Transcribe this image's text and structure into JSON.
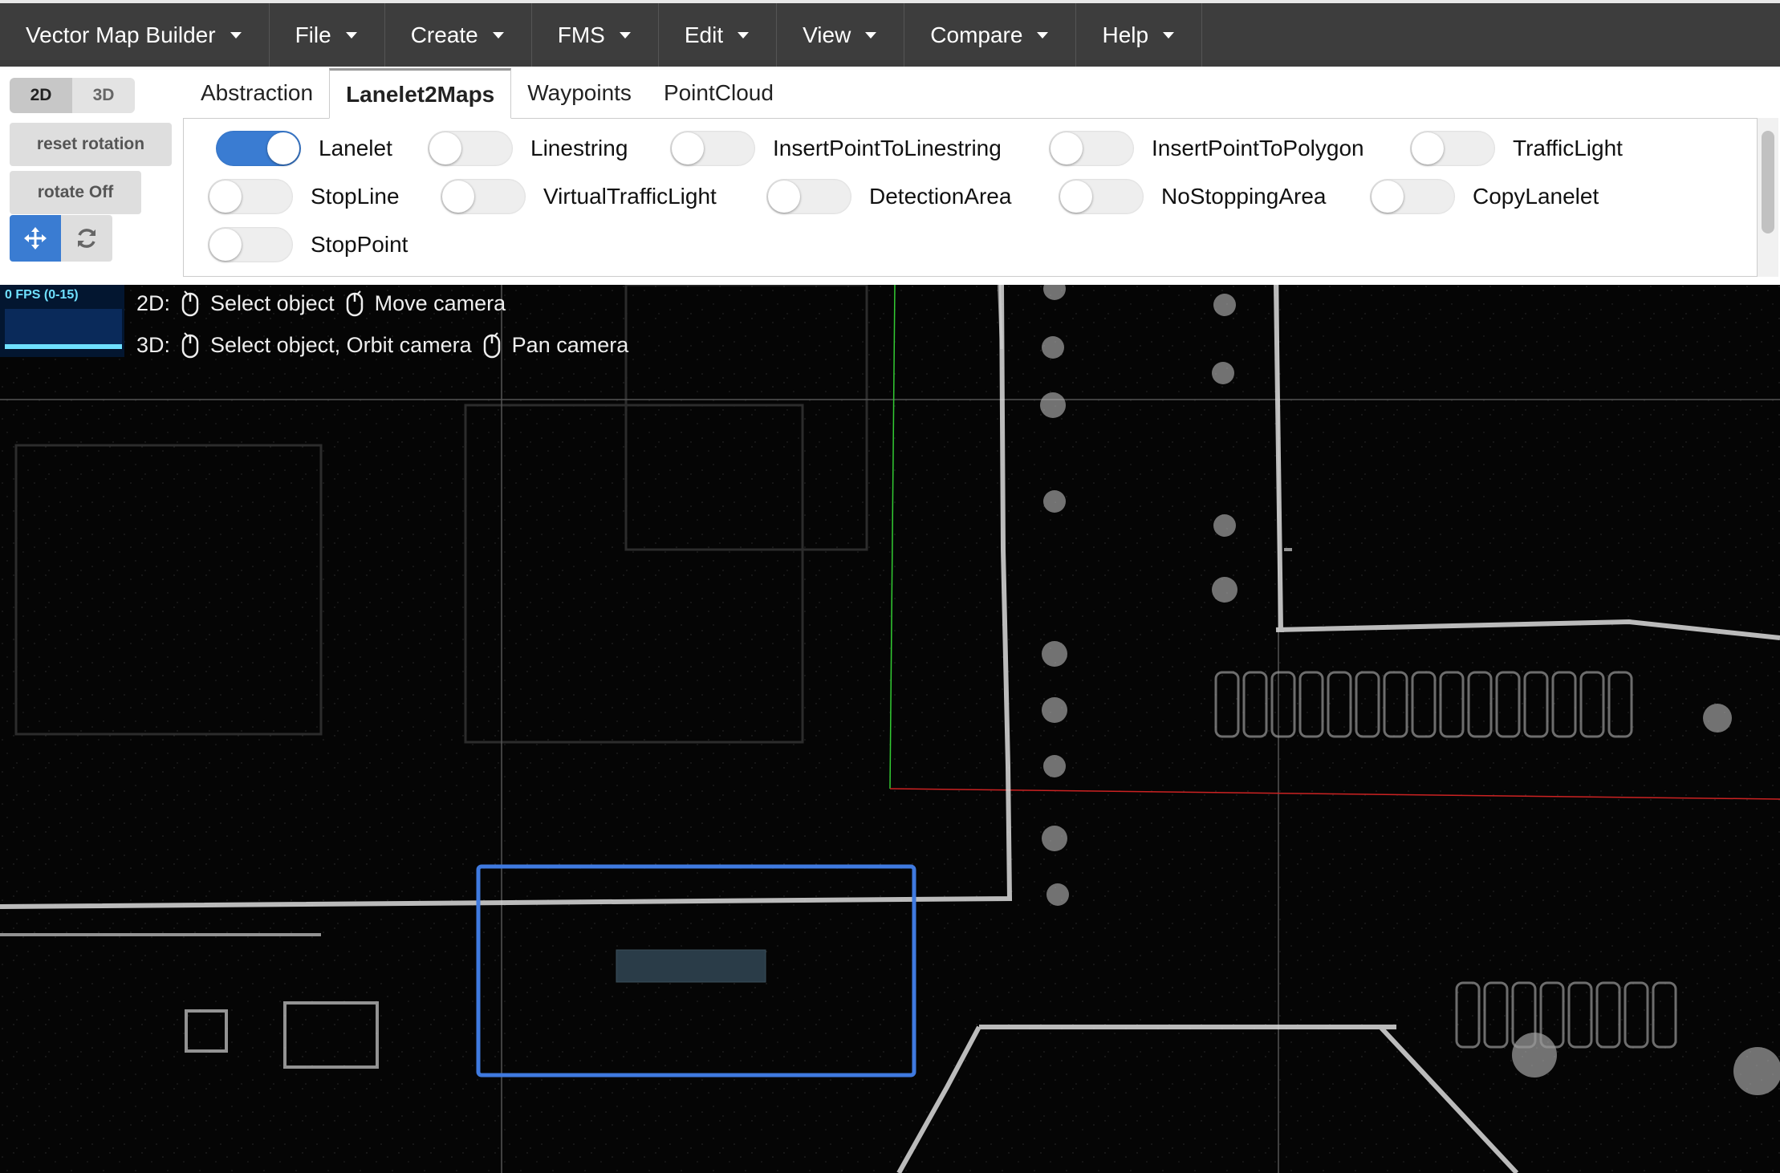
{
  "menubar": {
    "items": [
      "Vector Map Builder",
      "File",
      "Create",
      "FMS",
      "Edit",
      "View",
      "Compare",
      "Help"
    ]
  },
  "view_controls": {
    "mode_2d": "2D",
    "mode_3d": "3D",
    "active_mode": "2D",
    "reset_rotation_label": "reset rotation",
    "rotate_label": "rotate Off",
    "move_icon": "move-arrows-icon",
    "refresh_icon": "refresh-icon"
  },
  "tabs": {
    "items": [
      "Abstraction",
      "Lanelet2Maps",
      "Waypoints",
      "PointCloud"
    ],
    "active": "Lanelet2Maps"
  },
  "toggles": [
    {
      "label": "Lanelet",
      "on": true
    },
    {
      "label": "Linestring",
      "on": false
    },
    {
      "label": "InsertPointToLinestring",
      "on": false
    },
    {
      "label": "InsertPointToPolygon",
      "on": false
    },
    {
      "label": "TrafficLight",
      "on": false
    },
    {
      "label": "StopLine",
      "on": false
    },
    {
      "label": "VirtualTrafficLight",
      "on": false
    },
    {
      "label": "DetectionArea",
      "on": false
    },
    {
      "label": "NoStoppingArea",
      "on": false
    },
    {
      "label": "CopyLanelet",
      "on": false
    },
    {
      "label": "StopPoint",
      "on": false
    }
  ],
  "viewport": {
    "fps_label": "0 FPS (0-15)",
    "hint_2d": {
      "prefix": "2D:",
      "action1": "Select object",
      "action2": "Move camera"
    },
    "hint_3d": {
      "prefix": "3D:",
      "action1": "Select object, Orbit camera",
      "action2": "Pan camera"
    }
  },
  "colors": {
    "menubar_bg": "#3d3d3d",
    "toggle_on": "#3a7cd2",
    "selection_box": "#3f7ae0",
    "x_axis": "#cc2222",
    "y_axis": "#33cc33"
  }
}
